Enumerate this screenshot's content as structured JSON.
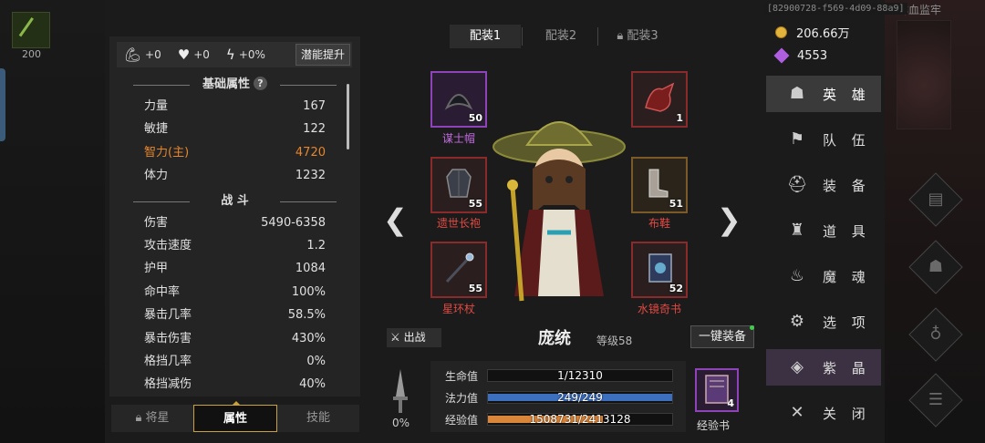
{
  "background": {
    "game_level": "200",
    "id_tag": "[82900728-f569-4d09-88a9]",
    "dungeon_title": "鲜血监牢"
  },
  "buffs": [
    {
      "icon": "strength-arm-icon",
      "value": "+0"
    },
    {
      "icon": "heart-icon",
      "value": "+0"
    },
    {
      "icon": "lightning-icon",
      "value": "+0%"
    }
  ],
  "boost_label": "潜能提升",
  "basic_title": "基础属性",
  "basic_stats": [
    {
      "label": "力量",
      "value": "167"
    },
    {
      "label": "敏捷",
      "value": "122"
    },
    {
      "label": "智力(主)",
      "value": "4720"
    },
    {
      "label": "体力",
      "value": "1232"
    }
  ],
  "combat_title": "战 斗",
  "combat_stats": [
    {
      "label": "伤害",
      "value": "5490-6358"
    },
    {
      "label": "攻击速度",
      "value": "1.2"
    },
    {
      "label": "护甲",
      "value": "1084"
    },
    {
      "label": "命中率",
      "value": "100%"
    },
    {
      "label": "暴击几率",
      "value": "58.5%"
    },
    {
      "label": "暴击伤害",
      "value": "430%"
    },
    {
      "label": "格挡几率",
      "value": "0%"
    },
    {
      "label": "格挡减伤",
      "value": "40%"
    }
  ],
  "bottom_tabs": [
    "将星",
    "属性",
    "技能"
  ],
  "loadout_tabs": [
    "配装1",
    "配装2",
    "配装3"
  ],
  "equipment": {
    "hat": {
      "name": "谋士帽",
      "level": "50"
    },
    "armor": {
      "name": "遗世长袍",
      "level": "55"
    },
    "staff": {
      "name": "星环杖",
      "level": "55"
    },
    "pet": {
      "level": "1"
    },
    "shoes": {
      "name": "布鞋",
      "level": "51"
    },
    "book": {
      "name": "水镜奇书",
      "level": "52"
    }
  },
  "hero": {
    "fight_label": "出战",
    "name": "庞统",
    "level": "等级58",
    "one_key_equip": "一键装备",
    "power_pct": "0%"
  },
  "bars": [
    {
      "label": "生命值",
      "text": "1/12310",
      "fraction": 0.0001,
      "color": "#3a3a3a"
    },
    {
      "label": "法力值",
      "text": "249/249",
      "fraction": 1.0,
      "color": "#3d6fbf"
    },
    {
      "label": "经验值",
      "text": "1508731/2413128",
      "fraction": 0.625,
      "color": "#d9853a"
    }
  ],
  "exp_book": {
    "label": "经验书",
    "count": "4"
  },
  "currency": {
    "gold": "206.66万",
    "gems": "4553"
  },
  "menu": [
    "英 雄",
    "队 伍",
    "装 备",
    "道 具",
    "魔 魂",
    "选 项",
    "紫 晶",
    "关 闭"
  ]
}
